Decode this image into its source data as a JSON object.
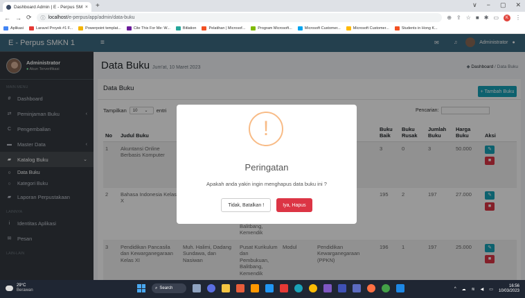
{
  "browser": {
    "tab_title": "Dashboard Admin | E - Perpus SMK",
    "tab_close": "×",
    "new_tab": "+",
    "url_host": "localhost",
    "url_path": "/e-perpus/app/admin/data-buku",
    "win_minimize": "∨",
    "win_min": "−",
    "win_max": "▢",
    "win_close": "✕",
    "bookmarks": [
      {
        "label": "Aplikasi",
        "color": "#4285f4"
      },
      {
        "label": "Laravel Proyek #1 F...",
        "color": "#e53935"
      },
      {
        "label": "Powerpoint templat...",
        "color": "#f4b400"
      },
      {
        "label": "Cite This For Me: W...",
        "color": "#6a1b9a"
      },
      {
        "label": "Bitlation",
        "color": "#26a69a"
      },
      {
        "label": "Pelatihan | Microsof...",
        "color": "#f25022"
      },
      {
        "label": "Program Microsoft...",
        "color": "#7fba00"
      },
      {
        "label": "Microsoft Customer...",
        "color": "#00a4ef"
      },
      {
        "label": "Microsoft Customer...",
        "color": "#ffb900"
      },
      {
        "label": "Students in Hong K...",
        "color": "#f25022"
      }
    ]
  },
  "sidebar": {
    "brand": "E - Perpus SMKN 1",
    "user_name": "Administrator",
    "user_status": "Akun Terverifikasi",
    "section_main": "MAIN MENU",
    "items": [
      {
        "label": "Dashboard",
        "icon": "#"
      },
      {
        "label": "Peminjaman Buku",
        "icon": "⇄",
        "chev": "‹"
      },
      {
        "label": "Pengembalian",
        "icon": "C"
      },
      {
        "label": "Master Data",
        "icon": "▬",
        "chev": "‹"
      },
      {
        "label": "Katalog Buku",
        "icon": "▰",
        "chev": "⌄"
      }
    ],
    "sub_items": [
      {
        "label": "Data Buku"
      },
      {
        "label": "Kategori Buku"
      }
    ],
    "report": "Laporan Perpustakaan",
    "section_other": "LAINNYA",
    "other_items": [
      {
        "label": "Identitas Aplikasi",
        "icon": "i"
      },
      {
        "label": "Pesan",
        "icon": "✉"
      }
    ],
    "section_last": "LAIN-LAIN"
  },
  "topnav": {
    "admin_label": "Administrator"
  },
  "page": {
    "title": "Data Buku",
    "date": "Jum'at, 10 Maret 2023",
    "crumb_home": "Dashboard",
    "crumb_sep": "/",
    "crumb_current": "Data Buku",
    "card_title": "Data Buku",
    "add_button": "+ Tambah Buku",
    "show_label": "Tampilkan",
    "show_value": "10",
    "entries_label": "entri",
    "search_label": "Pencarian:"
  },
  "table": {
    "headers": [
      "No",
      "Judul Buku",
      "",
      "",
      "",
      "",
      "Buku Baik",
      "Buku Rusak",
      "Jumlah Buku",
      "Harga Buku",
      "Aksi"
    ],
    "rows": [
      {
        "no": "1",
        "judul": "Akuntansi Online Berbasis Komputer",
        "c2": "",
        "c3": "",
        "c4": "",
        "c5": "",
        "baik": "3",
        "rusak": "0",
        "jumlah": "3",
        "harga": "50.000"
      },
      {
        "no": "2",
        "judul": "Bahasa Indonesia Kelas X",
        "c2": "",
        "c3": "Balitbang, Kemendik",
        "c4": "",
        "c5": "a",
        "baik": "195",
        "rusak": "2",
        "jumlah": "197",
        "harga": "27.000"
      },
      {
        "no": "3",
        "judul": "Pendidikan Pancasila dan Kewarganegaraan Kelas XI",
        "c2": "Muh. Halimi, Dadang Sundawa, dan Nasiwan",
        "c3": "Pusat Kurikulum dan Pembukuan, Balitbang, Kemendik",
        "c4": "Modul",
        "c5": "Pendidikan Kewarganegaraan (PPKN)",
        "baik": "196",
        "rusak": "1",
        "jumlah": "197",
        "harga": "25.000"
      }
    ]
  },
  "modal": {
    "icon": "!",
    "title": "Peringatan",
    "text": "Apakah anda yakin ingin menghapus data buku ini ?",
    "cancel": "Tidak, Batalkan !",
    "confirm": "Iya, Hapus"
  },
  "taskbar": {
    "temp": "29°C",
    "weather": "Berawan",
    "search": "Search",
    "time": "16:56",
    "date": "10/03/2023"
  }
}
